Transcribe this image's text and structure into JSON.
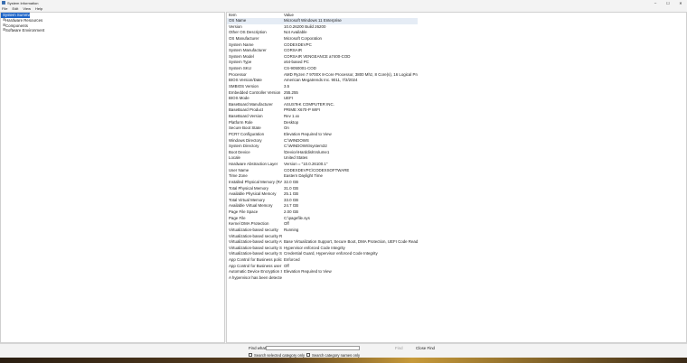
{
  "window": {
    "title": "System Information",
    "controls": {
      "minimize": "–",
      "maximize": "☐",
      "close": "✕"
    }
  },
  "menu": [
    "File",
    "Edit",
    "View",
    "Help"
  ],
  "tree": [
    {
      "label": "System Summary",
      "toggle": "",
      "selected": true
    },
    {
      "label": "Hardware Resources",
      "toggle": "⊞",
      "selected": false
    },
    {
      "label": "Components",
      "toggle": "⊞",
      "selected": false
    },
    {
      "label": "Software Environment",
      "toggle": "⊞",
      "selected": false
    }
  ],
  "table": {
    "headers": {
      "item": "Item",
      "value": "Value"
    },
    "rows": [
      [
        "OS Name",
        "Microsoft Windows 11 Enterprise"
      ],
      [
        "Version",
        "10.0.26200 Build 26200"
      ],
      [
        "Other OS Description",
        "Not Available"
      ],
      [
        "OS Manufacturer",
        "Microsoft Corporation"
      ],
      [
        "System Name",
        "CODEXDEVPC"
      ],
      [
        "System Manufacturer",
        "CORSAIR"
      ],
      [
        "System Model",
        "CORSAIR VENGEANCE a7400-COD"
      ],
      [
        "System Type",
        "x64-based PC"
      ],
      [
        "System SKU",
        "CS-9050001-COD"
      ],
      [
        "Processor",
        "AMD Ryzen 7 9700X 8-Core Processor, 3800 Mhz, 8 Core(s), 16 Logical Process..."
      ],
      [
        "BIOS Version/Date",
        "American Megatrends Inc. 9011, 7/3/2024"
      ],
      [
        "SMBIOS Version",
        "3.5"
      ],
      [
        "Embedded Controller Version",
        "255.255"
      ],
      [
        "BIOS Mode",
        "UEFI"
      ],
      [
        "BaseBoard Manufacturer",
        "ASUSTeK COMPUTER INC."
      ],
      [
        "BaseBoard Product",
        "PRIME X670-P WIFI"
      ],
      [
        "BaseBoard Version",
        "Rev 1.xx"
      ],
      [
        "Platform Role",
        "Desktop"
      ],
      [
        "Secure Boot State",
        "On"
      ],
      [
        "PCR7 Configuration",
        "Elevation Required to View"
      ],
      [
        "Windows Directory",
        "C:\\WINDOWS"
      ],
      [
        "System Directory",
        "C:\\WINDOWS\\system32"
      ],
      [
        "Boot Device",
        "\\Device\\HarddiskVolume1"
      ],
      [
        "Locale",
        "United States"
      ],
      [
        "Hardware Abstraction Layer",
        "Version = \"10.0.26100.1\""
      ],
      [
        "User Name",
        "CODEXDEVPC\\CODEXSOFTWARE"
      ],
      [
        "Time Zone",
        "Eastern Daylight Time"
      ],
      [
        "Installed Physical Memory (RAM)",
        "32.0 GB"
      ],
      [
        "Total Physical Memory",
        "31.0 GB"
      ],
      [
        "Available Physical Memory",
        "25.1 GB"
      ],
      [
        "Total Virtual Memory",
        "33.0 GB"
      ],
      [
        "Available Virtual Memory",
        "24.7 GB"
      ],
      [
        "Page File Space",
        "2.00 GB"
      ],
      [
        "Page File",
        "C:\\pagefile.sys"
      ],
      [
        "Kernel DMA Protection",
        "Off"
      ],
      [
        "Virtualization-based security",
        "Running"
      ],
      [
        "Virtualization-based security Re...",
        ""
      ],
      [
        "Virtualization-based security Av...",
        "Base Virtualization Support, Secure Boot, DMA Protection, UEFI Code Readonly..."
      ],
      [
        "Virtualization-based security Se...",
        "Hypervisor enforced Code Integrity"
      ],
      [
        "Virtualization-based security Se...",
        "Credential Guard, Hypervisor enforced Code Integrity"
      ],
      [
        "App Control for Business policy",
        "Enforced"
      ],
      [
        "App Control for Business user m...",
        "Off"
      ],
      [
        "Automatic Device Encryption Su...",
        "Elevation Required to View"
      ],
      [
        "A hypervisor has been detected...",
        ""
      ]
    ]
  },
  "find": {
    "label": "Find what:",
    "value": "",
    "find_button": "Find",
    "close_button": "Close Find",
    "opt_selected": "Search selected category only",
    "opt_names": "Search category names only"
  }
}
